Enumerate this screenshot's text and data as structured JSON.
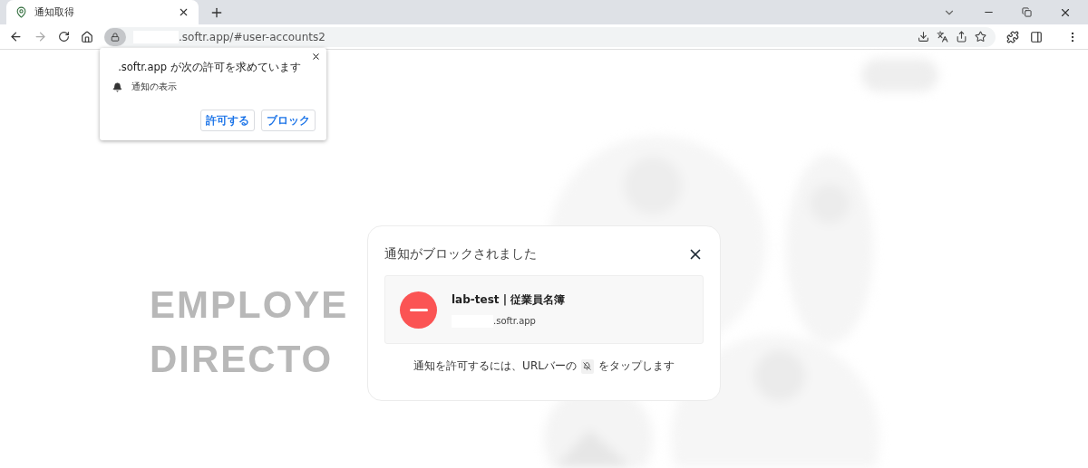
{
  "tab": {
    "title": "通知取得",
    "selected": true
  },
  "address_bar": {
    "url": ".softr.app/#user-accounts2"
  },
  "permission_popup": {
    "title": ".softr.app が次の許可を求めています",
    "permission": "通知の表示",
    "buttons": [
      "許可する",
      "ブロック"
    ]
  },
  "background": {
    "heading": [
      "EMPLOYE",
      "DIRECTO"
    ]
  },
  "modal": {
    "title": "通知がブロックされました",
    "site_name": "lab-test | 従業員名簿",
    "site_domain": ".softr.app",
    "hint_before": "通知を許可するには、URLバーの",
    "hint_after": "をタップします"
  }
}
